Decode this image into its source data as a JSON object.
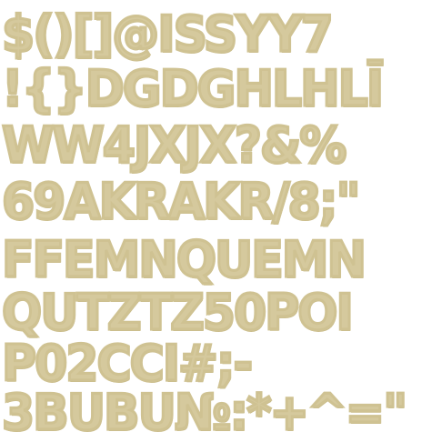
{
  "glyph_sheet": {
    "ink_color": "#d5c99d",
    "rows": [
      {
        "id": "row-1",
        "text": "$()[]@ISSYY7"
      },
      {
        "id": "row-2",
        "text": "!{}DGDGHLHLĪ"
      },
      {
        "id": "row-3",
        "text": "WW4JXJX?&%"
      },
      {
        "id": "row-4",
        "text": "69AKRAKR/8;\""
      },
      {
        "id": "row-5",
        "text": "FFEMNQUEMN"
      },
      {
        "id": "row-6",
        "text": "QUTZTZ50POI"
      },
      {
        "id": "row-7",
        "text": "P02CCI#;-"
      },
      {
        "id": "row-8",
        "text": "3BUBU№:*+^=\""
      }
    ]
  }
}
